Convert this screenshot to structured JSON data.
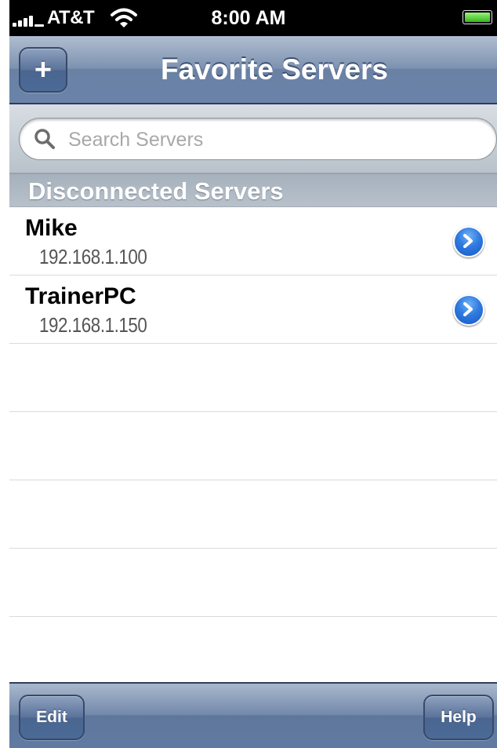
{
  "status_bar": {
    "carrier": "AT&T",
    "time": "8:00 AM",
    "signal_icon": "signal-bars-icon",
    "wifi_icon": "wifi-icon",
    "battery_icon": "battery-icon",
    "battery_level": 1.0,
    "battery_color": "#34b81a"
  },
  "nav_bar": {
    "title": "Favorite Servers",
    "add_label": "+"
  },
  "search": {
    "placeholder": "Search Servers",
    "value": "",
    "icon": "search-icon"
  },
  "section": {
    "title": "Disconnected Servers"
  },
  "servers": [
    {
      "name": "Mike",
      "address": "192.168.1.100"
    },
    {
      "name": "TrainerPC",
      "address": "192.168.1.150"
    }
  ],
  "toolbar": {
    "edit_label": "Edit",
    "help_label": "Help"
  },
  "colors": {
    "nav_bar": "#6b83a9",
    "accent": "#2f7ae0"
  }
}
